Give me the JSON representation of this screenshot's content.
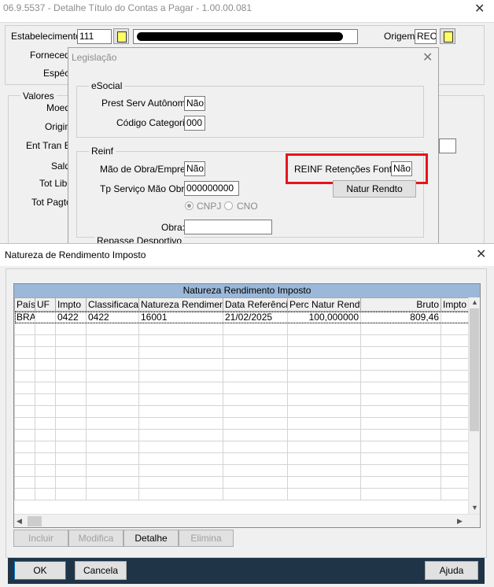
{
  "main_window": {
    "title": "06.9.5537 - Detalhe Título do Contas a Pagar - 1.00.00.081",
    "estabelecimento_label": "Estabelecimento:",
    "estabelecimento_value": "111",
    "origem_label": "Origem:",
    "origem_value": "REC",
    "fornecedor_label": "Fornecedo",
    "especie_label": "Espéci",
    "valores_group": "Valores",
    "valores_labels": [
      "Moed",
      "Origin",
      "Ent Tran E",
      "Sald",
      "Tot Libe",
      "Tot Pagto"
    ]
  },
  "legislacao": {
    "title": "Legislação",
    "esocial_group": "eSocial",
    "prest_serv_label": "Prest Serv Autônomo:",
    "prest_serv_value": "Não",
    "codigo_categoria_label": "Código Categoria:",
    "codigo_categoria_value": "000",
    "reinf_group": "Reinf",
    "mao_obra_label": "Mão de Obra/Empreit:",
    "mao_obra_value": "Não",
    "tp_servico_label": "Tp Serviço Mão Obra:",
    "tp_servico_value": "000000000",
    "cnpj_label": "CNPJ",
    "cno_label": "CNO",
    "obra_label": "Obra:",
    "obra_value": "",
    "reinf_retencoes_label": "REINF Retenções Fonte:",
    "reinf_retencoes_value": "Não",
    "natur_rendto_button": "Natur Rendto",
    "repasse_group": "Repasse Desportivo",
    "highlight_color": "#e8141b"
  },
  "natureza": {
    "title": "Natureza de Rendimento Imposto",
    "grid_caption": "Natureza Rendimento Imposto",
    "columns": [
      "País",
      "UF",
      "Impto",
      "Classificacao",
      "Natureza Rendimento",
      "Data Referência",
      "Perc Natur Rendto",
      "Bruto",
      "Impto E"
    ],
    "rows": [
      [
        "BRA",
        "",
        "0422",
        "0422",
        "16001",
        "21/02/2025",
        "100,000000",
        "809,46",
        ""
      ]
    ],
    "buttons": {
      "incluir": "Incluir",
      "modifica": "Modifica",
      "detalhe": "Detalhe",
      "elimina": "Elimina"
    },
    "footer": {
      "ok": "OK",
      "cancela": "Cancela",
      "ajuda": "Ajuda"
    },
    "caption_color": "#9bb8d9"
  }
}
